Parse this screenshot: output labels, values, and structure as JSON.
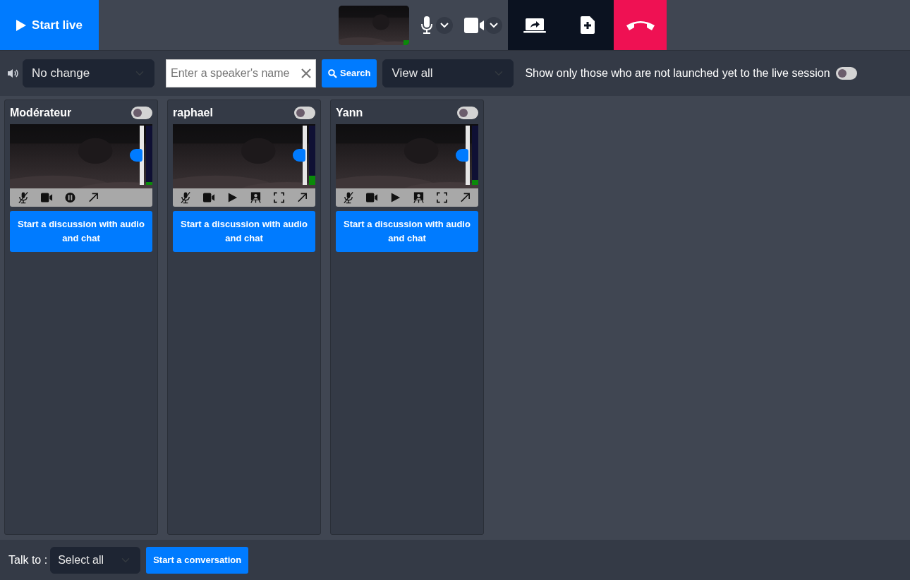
{
  "top_bar": {
    "start_live": "Start live",
    "live_indicator": true
  },
  "toolbar": {
    "audio_select": "No change",
    "search": {
      "placeholder": "Enter a speaker's name"
    },
    "search_button": "Search",
    "view_select": "View all",
    "filter_label": "Show only those who are not launched yet to the live session",
    "filter_on": false
  },
  "participants": [
    {
      "name": "Modérateur",
      "on": false,
      "volume": {
        "level": 0.5
      },
      "meter": {
        "level": 0.05
      },
      "controls": [
        {
          "kind": "mute"
        },
        {
          "kind": "camera"
        },
        {
          "kind": "pause"
        },
        {
          "kind": "popout"
        }
      ],
      "button": "Start a discussion with audio and chat"
    },
    {
      "name": "raphael",
      "on": false,
      "volume": {
        "level": 0.5
      },
      "meter": {
        "level": 0.15
      },
      "controls": [
        {
          "kind": "mute"
        },
        {
          "kind": "camera"
        },
        {
          "kind": "play"
        },
        {
          "kind": "presenter"
        },
        {
          "kind": "fullscreen"
        },
        {
          "kind": "popout"
        }
      ],
      "button": "Start a discussion with audio and chat"
    },
    {
      "name": "Yann",
      "on": false,
      "volume": {
        "level": 0.5
      },
      "meter": {
        "level": 0.08
      },
      "controls": [
        {
          "kind": "mute"
        },
        {
          "kind": "camera"
        },
        {
          "kind": "play"
        },
        {
          "kind": "presenter"
        },
        {
          "kind": "fullscreen"
        },
        {
          "kind": "popout"
        }
      ],
      "button": "Start a discussion with audio and chat"
    }
  ],
  "bottom_bar": {
    "label": "Talk to :",
    "select": "Select all",
    "button": "Start a conversation"
  }
}
